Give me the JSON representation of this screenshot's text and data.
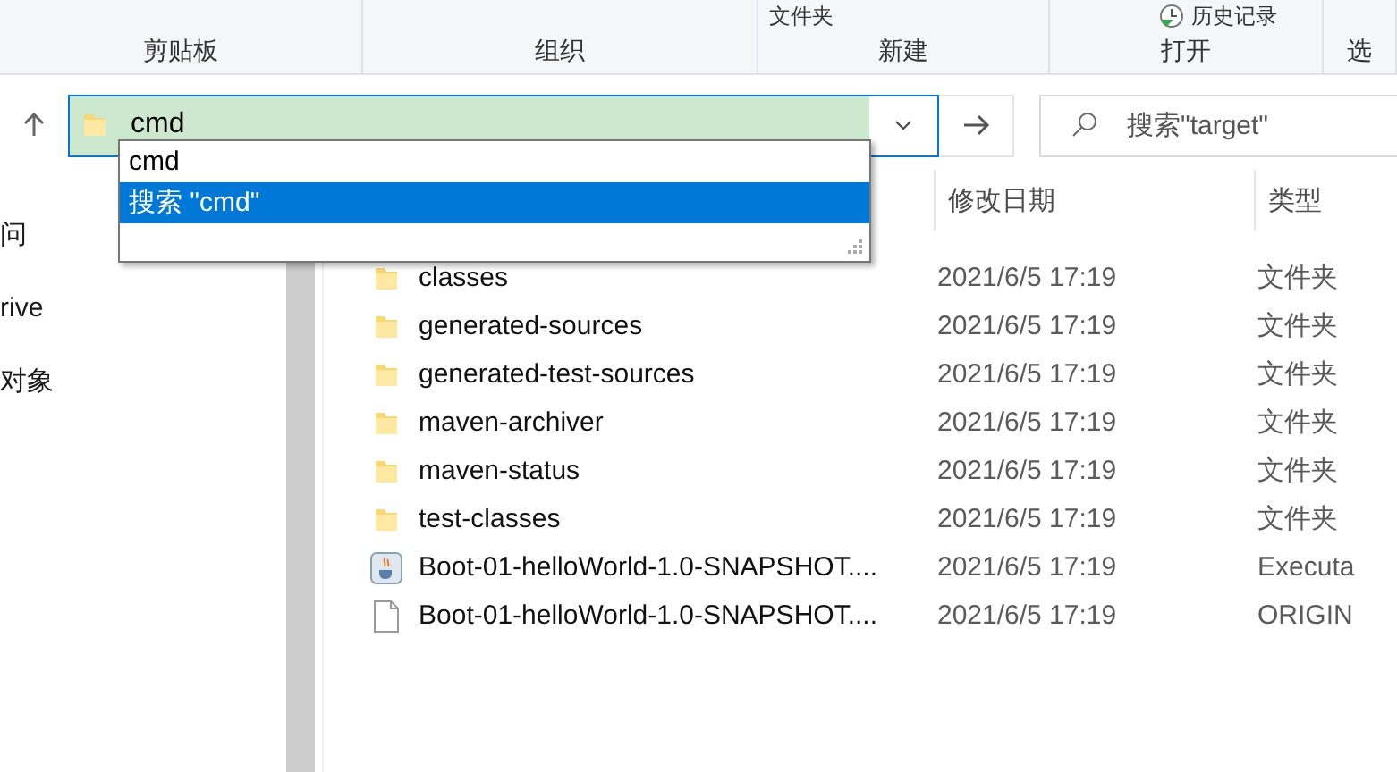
{
  "ribbon": {
    "groups": [
      {
        "label": "剪贴板"
      },
      {
        "label": "组织"
      },
      {
        "label": "新建",
        "top_text": "文件夹",
        "kind": "text"
      },
      {
        "label": "打开",
        "top_text": "历史记录",
        "kind": "history"
      },
      {
        "label": "选"
      }
    ]
  },
  "address_bar": {
    "value": "cmd"
  },
  "autocomplete": [
    {
      "label": "cmd",
      "selected": false
    },
    {
      "label": "搜索 \"cmd\"",
      "selected": true
    }
  ],
  "search": {
    "placeholder": "搜索\"target\""
  },
  "nav_pane": {
    "items": [
      "问",
      "rive",
      "对象"
    ]
  },
  "file_list": {
    "columns": [
      "修改日期",
      "类型"
    ],
    "rows": [
      {
        "kind": "folder",
        "name": "classes",
        "date": "2021/6/5 17:19",
        "type": "文件夹"
      },
      {
        "kind": "folder",
        "name": "generated-sources",
        "date": "2021/6/5 17:19",
        "type": "文件夹"
      },
      {
        "kind": "folder",
        "name": "generated-test-sources",
        "date": "2021/6/5 17:19",
        "type": "文件夹"
      },
      {
        "kind": "folder",
        "name": "maven-archiver",
        "date": "2021/6/5 17:19",
        "type": "文件夹"
      },
      {
        "kind": "folder",
        "name": "maven-status",
        "date": "2021/6/5 17:19",
        "type": "文件夹"
      },
      {
        "kind": "folder",
        "name": "test-classes",
        "date": "2021/6/5 17:19",
        "type": "文件夹"
      },
      {
        "kind": "jar",
        "name": "Boot-01-helloWorld-1.0-SNAPSHOT....",
        "date": "2021/6/5 17:19",
        "type": "Executa"
      },
      {
        "kind": "file",
        "name": "Boot-01-helloWorld-1.0-SNAPSHOT....",
        "date": "2021/6/5 17:19",
        "type": "ORIGIN"
      }
    ]
  }
}
